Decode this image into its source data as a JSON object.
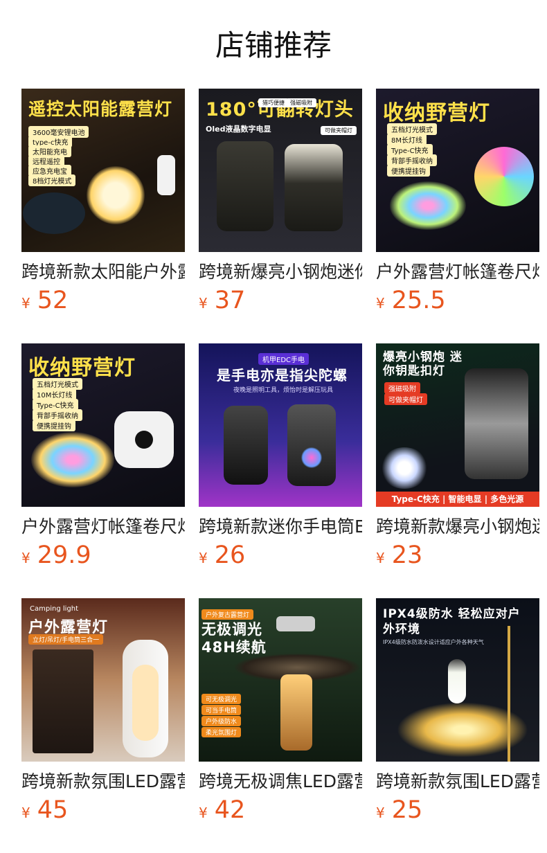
{
  "page": {
    "title": "店铺推荐"
  },
  "products": [
    {
      "name": "跨境新款太阳能户外露营灯",
      "price": "52",
      "currency": "¥",
      "image": {
        "headline": "遥控太阳能露营灯",
        "tags": [
          "3600毫安锂电池",
          "type-c快充",
          "太阳能充电",
          "远程遥控",
          "应急充电宝",
          "8档灯光模式"
        ]
      }
    },
    {
      "name": "跨境新爆亮小钢炮迷你手电",
      "price": "37",
      "currency": "¥",
      "image": {
        "headline": "180°可翻转灯头",
        "subhead": "Oled液晶数字电显",
        "tags": [
          "猎巧便捷",
          "强磁吸附",
          "可做夹帽灯"
        ]
      }
    },
    {
      "name": "户外露营灯帐篷卷尺灯",
      "price": "25.5",
      "currency": "¥",
      "image": {
        "headline": "收纳野营灯",
        "tags": [
          "五档灯光模式",
          "8M长灯线",
          "Type-C快充",
          "背部手摇收纳",
          "便携提挂钩"
        ]
      }
    },
    {
      "name": "户外露营灯帐篷卷尺灯",
      "price": "29.9",
      "currency": "¥",
      "image": {
        "headline": "收纳野营灯",
        "tags": [
          "五档灯光模式",
          "10M长灯线",
          "Type-C快充",
          "背部手摇收纳",
          "便携提挂钩"
        ]
      }
    },
    {
      "name": "跨境新款迷你手电筒EDC",
      "price": "26",
      "currency": "¥",
      "image": {
        "headline": "是手电亦是指尖陀螺",
        "subhead": "夜晚是照明工具，烦怡时是解压玩具",
        "tags": [
          "机甲EDC手电"
        ]
      }
    },
    {
      "name": "跨境新款爆亮小钢炮迷你",
      "price": "23",
      "currency": "¥",
      "image": {
        "headline": "爆亮小钢炮 迷你钥匙扣灯",
        "tags": [
          "强磁吸附",
          "可做夹帽灯"
        ],
        "footer": "Type-C快充 | 智能电显 | 多色光源"
      }
    },
    {
      "name": "跨境新款氛围LED露营灯",
      "price": "45",
      "currency": "¥",
      "image": {
        "headline": "户外露营灯",
        "subhead": "Camping light",
        "tags": [
          "立灯/吊灯/手电筒三合一"
        ]
      }
    },
    {
      "name": "跨境无极调焦LED露营灯",
      "price": "42",
      "currency": "¥",
      "image": {
        "headline": "无极调光 48H续航",
        "tags": [
          "户外复古露营灯",
          "可无极调光",
          "可当手电筒",
          "户外级防水",
          "柔光氛围灯"
        ]
      }
    },
    {
      "name": "跨境新款氛围LED露营灯",
      "price": "25",
      "currency": "¥",
      "image": {
        "headline": "IPX4级防水 轻松应对户外环境",
        "subhead": "IPX4级防水防泼水设计适应户外各种天气"
      }
    }
  ],
  "colors": {
    "price": "#e8551e",
    "text": "#222222",
    "background": "#ffffff"
  }
}
